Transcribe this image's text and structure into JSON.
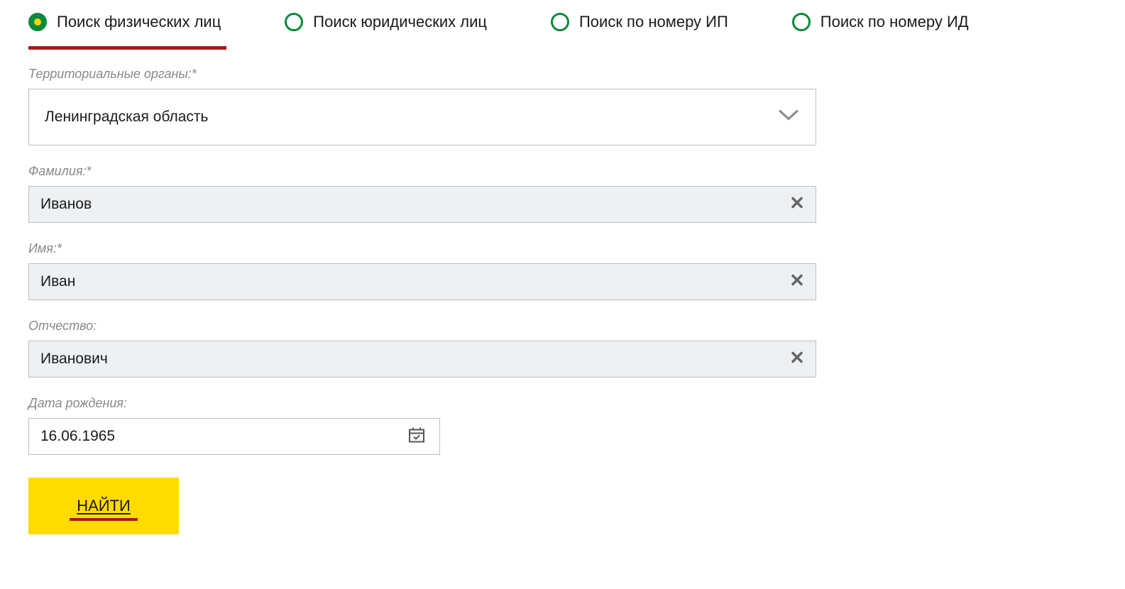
{
  "tabs": [
    {
      "label": "Поиск физических лиц",
      "selected": true
    },
    {
      "label": "Поиск юридических лиц",
      "selected": false
    },
    {
      "label": "Поиск по номеру ИП",
      "selected": false
    },
    {
      "label": "Поиск по номеру ИД",
      "selected": false
    }
  ],
  "form": {
    "region": {
      "label": "Территориальные органы:*",
      "value": "Ленинградская область"
    },
    "lastname": {
      "label": "Фамилия:*",
      "value": "Иванов"
    },
    "firstname": {
      "label": "Имя:*",
      "value": "Иван"
    },
    "patronymic": {
      "label": "Отчество:",
      "value": "Иванович"
    },
    "birthdate": {
      "label": "Дата рождения:",
      "value": "16.06.1965"
    },
    "submit": "НАЙТИ"
  }
}
